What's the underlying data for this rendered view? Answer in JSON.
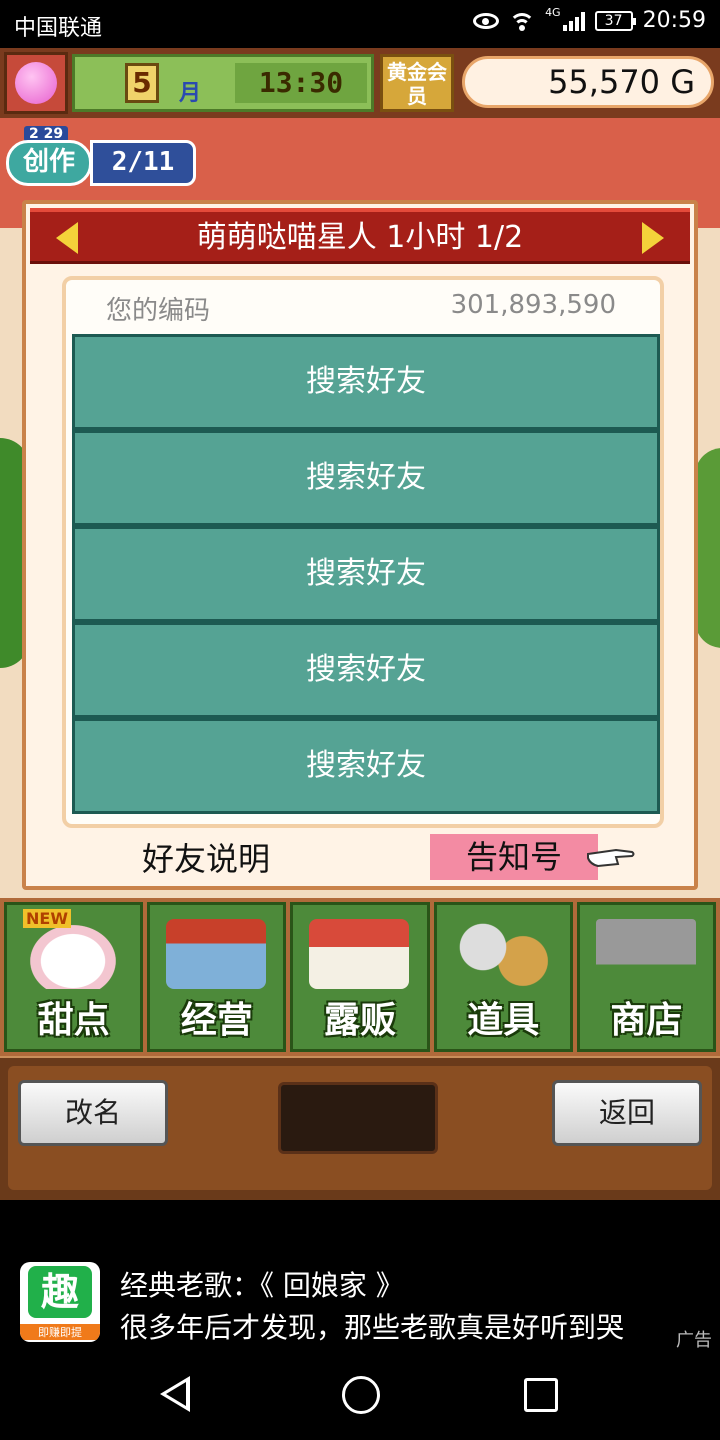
{
  "statusbar": {
    "carrier": "中国联通",
    "network": "4G",
    "battery": "37",
    "time": "20:59"
  },
  "topbar": {
    "month": "5",
    "month_label": "月",
    "clock": "13:30",
    "gold_member": "黄金会员",
    "money": "55,570 G"
  },
  "create_badge": {
    "date": "2 29",
    "label": "创作",
    "count": "2/11"
  },
  "dialog": {
    "title": "萌萌哒喵星人  1小时 1/2",
    "code_label": "您的编码",
    "code_value": "301,893,590",
    "slots": [
      "搜索好友",
      "搜索好友",
      "搜索好友",
      "搜索好友",
      "搜索好友"
    ],
    "friend_help": "好友说明",
    "notice": "告知号"
  },
  "menu": {
    "new_tag": "NEW",
    "items": [
      {
        "label": "甜点",
        "icon": "cake-icon"
      },
      {
        "label": "经营",
        "icon": "shop-icon"
      },
      {
        "label": "露贩",
        "icon": "food-truck-icon"
      },
      {
        "label": "道具",
        "icon": "items-bag-icon"
      },
      {
        "label": "商店",
        "icon": "cart-icon"
      }
    ]
  },
  "bottom": {
    "rename": "改名",
    "back": "返回"
  },
  "ad": {
    "logo_glyph": "趣",
    "logo_sub": "即赚即提",
    "title": "经典老歌：《 回娘家 》",
    "desc": "很多年后才发现，那些老歌真是好听到哭",
    "tag": "广告"
  },
  "colors": {
    "header_red": "#a51f18",
    "slot_teal": "#55a394",
    "notice_pink": "#f38ba3",
    "menu_green": "#4d8a3a"
  }
}
